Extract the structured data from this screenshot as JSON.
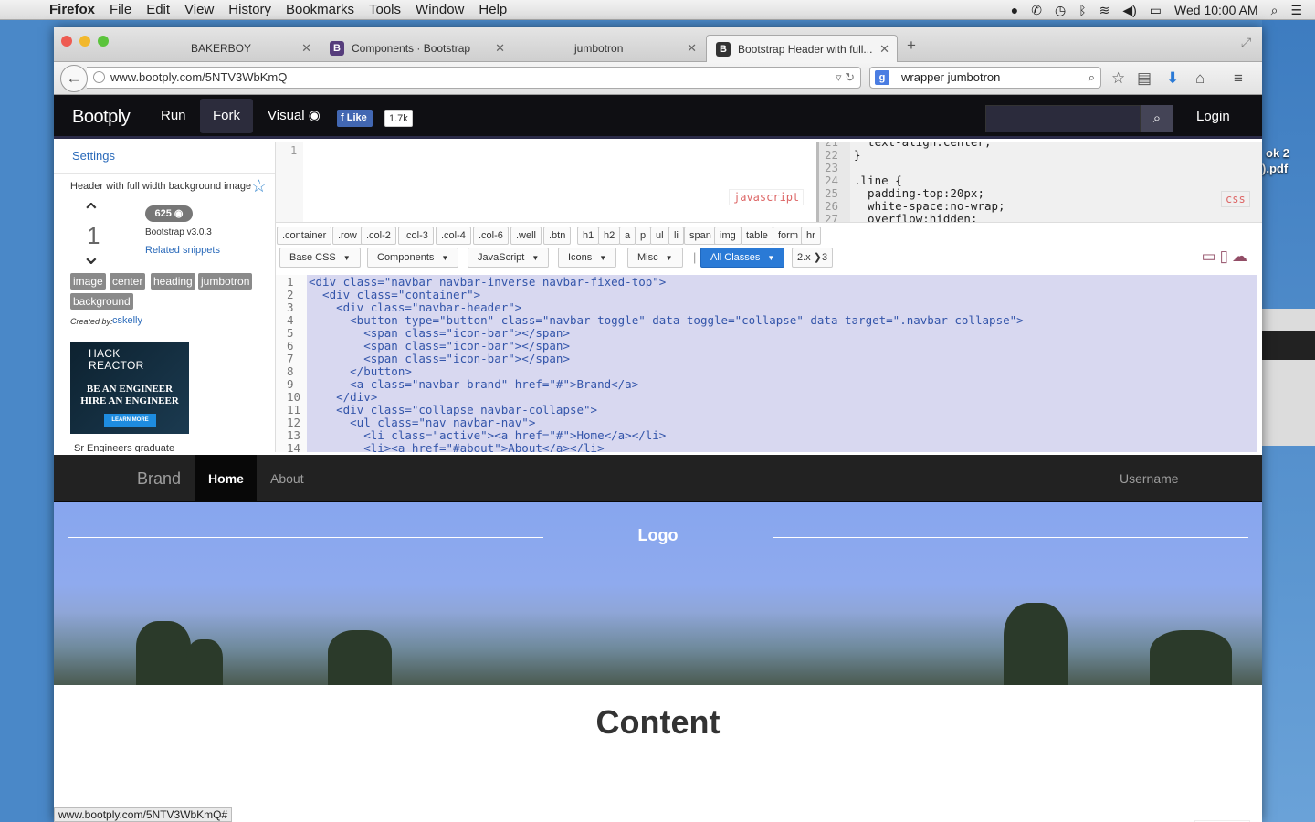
{
  "menubar": {
    "app": "Firefox",
    "items": [
      "File",
      "Edit",
      "View",
      "History",
      "Bookmarks",
      "Tools",
      "Window",
      "Help"
    ],
    "clock": "Wed 10:00 AM"
  },
  "desktop": {
    "file1": "ok 2",
    "file2": ").pdf"
  },
  "tabs": [
    {
      "label": "BAKERBOY"
    },
    {
      "label": "Components · Bootstrap"
    },
    {
      "label": "jumbotron"
    },
    {
      "label": "Bootstrap Header with full..."
    }
  ],
  "browser": {
    "url": "www.bootply.com/5NTV3WbKmQ",
    "search_value": "wrapper jumbotron"
  },
  "bootply": {
    "brand": "Bootply",
    "run": "Run",
    "fork": "Fork",
    "visual": "Visual",
    "like": "Like",
    "like_count": "1.7k",
    "login": "Login"
  },
  "sidebar": {
    "settings": "Settings",
    "title": "Header with full width background image",
    "votes": "1",
    "views": "625",
    "bootstrap_version": "Bootstrap v3.0.3",
    "related": "Related snippets",
    "tags": [
      "image",
      "center",
      "heading",
      "jumbotron",
      "background"
    ],
    "created_by": "Created by:",
    "author": "cskelly",
    "ad": {
      "logo1": "HACK",
      "logo2": "REACTOR",
      "line1": "BE AN ENGINEER",
      "line2": "HIRE AN ENGINEER",
      "button": "LEARN MORE"
    },
    "bottom_text": "Sr Engineers graduate"
  },
  "js_editor": {
    "line": "1",
    "tag": "javascript"
  },
  "css_editor": {
    "tag": "css",
    "lines": [
      {
        "n": "21",
        "code": "  text-align:center;"
      },
      {
        "n": "22",
        "code": "}"
      },
      {
        "n": "23",
        "code": ""
      },
      {
        "n": "24",
        "code": ".line {"
      },
      {
        "n": "25",
        "code": "  padding-top:20px;"
      },
      {
        "n": "26",
        "code": "  white-space:no-wrap;"
      },
      {
        "n": "27",
        "code": "  overflow:hidden;"
      }
    ]
  },
  "snippet_buttons": [
    ".container",
    ".row",
    ".col-2",
    ".col-3",
    ".col-4",
    ".col-6",
    ".well",
    ".btn",
    "h1",
    "h2",
    "a",
    "p",
    "ul",
    "li",
    "span",
    "img",
    "table",
    "form",
    "hr"
  ],
  "dropdowns": [
    "Base CSS",
    "Components",
    "JavaScript",
    "Icons",
    "Misc",
    "All Classes"
  ],
  "zoom": "2.x",
  "zoom_suffix": "3",
  "html_lines": [
    "1",
    "2",
    "3",
    "4",
    "5",
    "6",
    "7",
    "8",
    "9",
    "10",
    "11",
    "12",
    "13",
    "14"
  ],
  "html_code": [
    "<div class=\"navbar navbar-inverse navbar-fixed-top\">",
    "  <div class=\"container\">",
    "    <div class=\"navbar-header\">",
    "      <button type=\"button\" class=\"navbar-toggle\" data-toggle=\"collapse\" data-target=\".navbar-collapse\">",
    "        <span class=\"icon-bar\"></span>",
    "        <span class=\"icon-bar\"></span>",
    "        <span class=\"icon-bar\"></span>",
    "      </button>",
    "      <a class=\"navbar-brand\" href=\"#\">Brand</a>",
    "    </div>",
    "    <div class=\"collapse navbar-collapse\">",
    "      <ul class=\"nav navbar-nav\">",
    "        <li class=\"active\"><a href=\"#\">Home</a></li>",
    "        <li><a href=\"#about\">About</a></li>"
  ],
  "preview": {
    "brand": "Brand",
    "home": "Home",
    "about": "About",
    "username": "Username",
    "logo": "Logo",
    "content": "Content",
    "tag": "preview"
  },
  "status_url": "www.bootply.com/5NTV3WbKmQ#"
}
